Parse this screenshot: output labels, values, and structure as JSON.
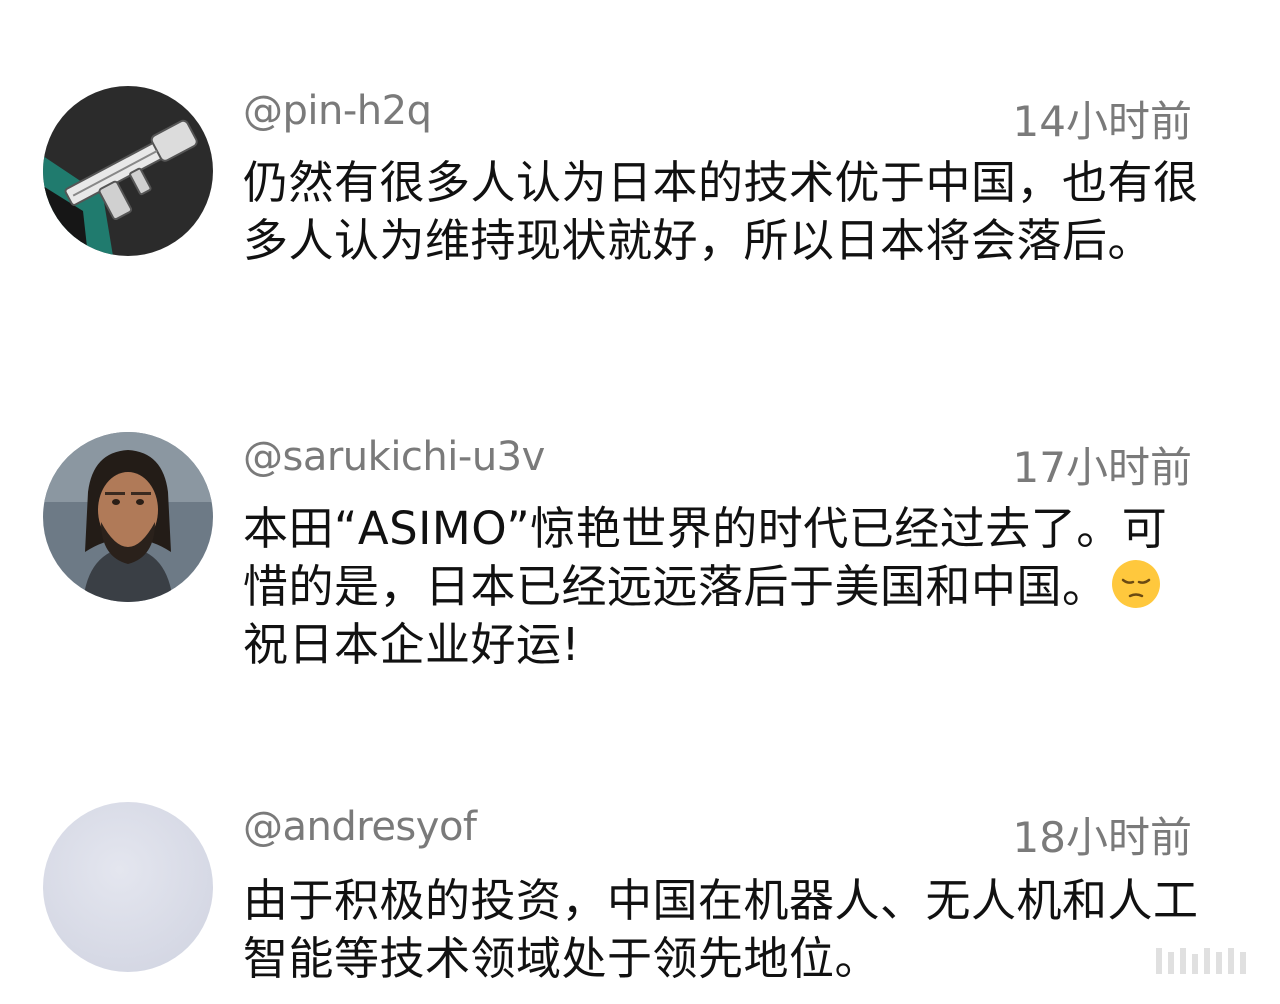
{
  "comments": [
    {
      "username": "@pin-h2q",
      "time": "14小时前",
      "text": "仍然有很多人认为日本的技术优于中国，也有很多人认为维持现状就好，所以日本将会落后。",
      "avatar": "gun-icon"
    },
    {
      "username": "@sarukichi-u3v",
      "time": "17小时前",
      "text_before": "本田“ASIMO”惊艳世界的时代已经过去了。可惜的是，日本已经远远落后于美国和中国。",
      "emoji": "pensive-face-emoji",
      "text_after": "祝日本企业好运!",
      "avatar": "bearded-man-portrait"
    },
    {
      "username": "@andresyof",
      "time": "18小时前",
      "text": "由于积极的投资，中国在机器人、无人机和人工智能等技术领域处于领先地位。",
      "avatar": "blank-avatar"
    }
  ],
  "colors": {
    "meta_text": "#7a7a7a",
    "body_text": "#111111",
    "background": "#ffffff"
  }
}
